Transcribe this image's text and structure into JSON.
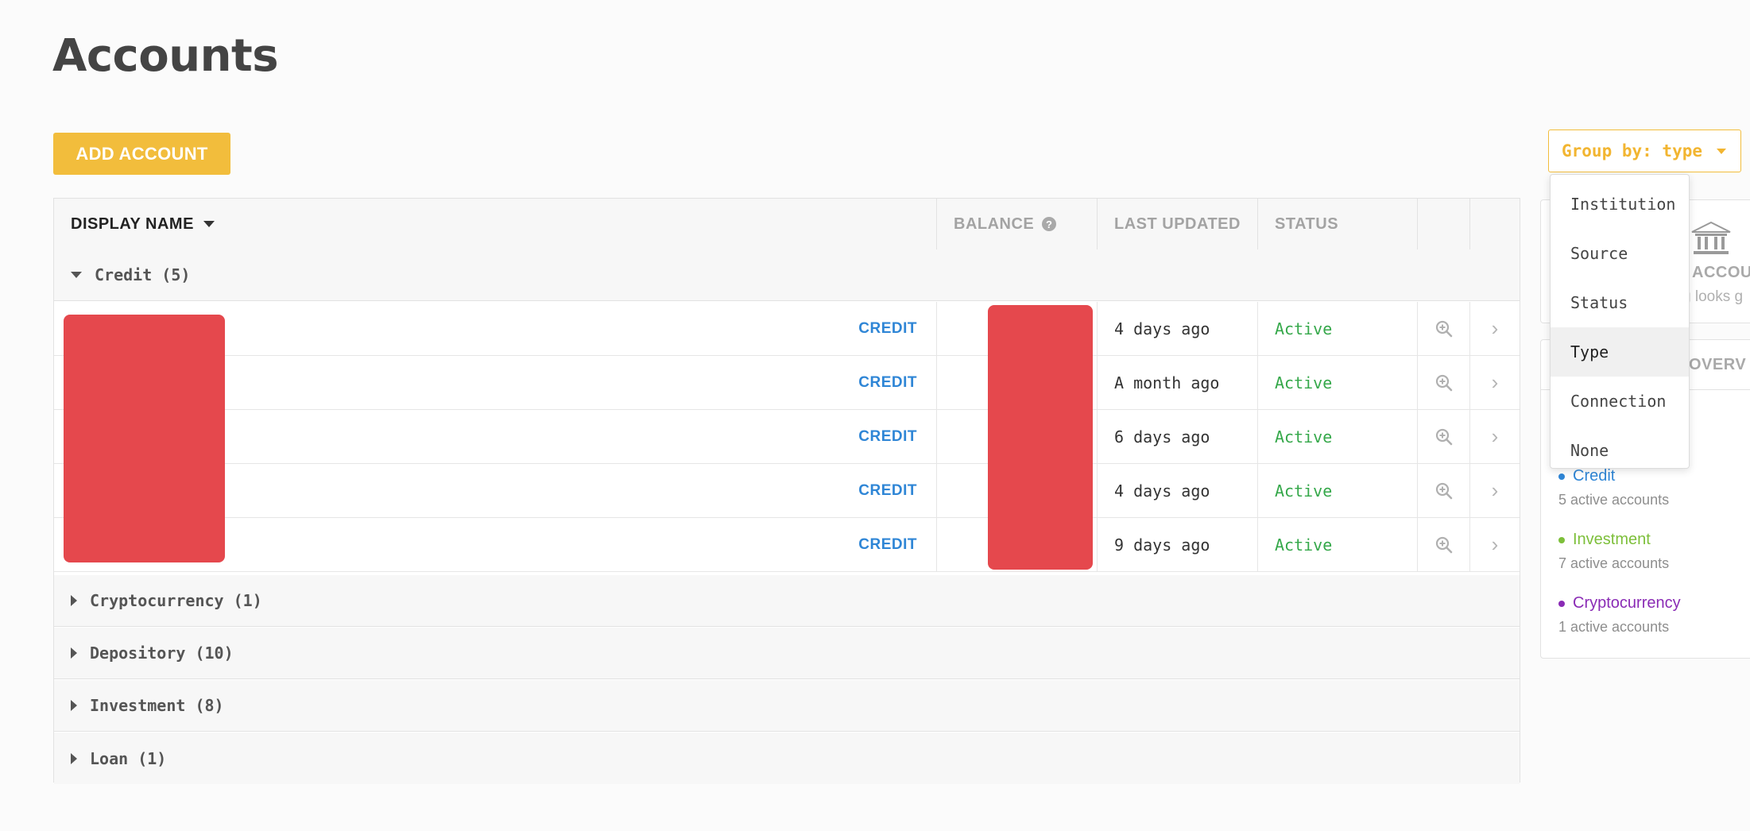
{
  "page": {
    "title": "Accounts"
  },
  "toolbar": {
    "add_label": "ADD ACCOUNT",
    "group_by_label": "Group by: type"
  },
  "group_by_menu": {
    "options": [
      "Institution",
      "Source",
      "Status",
      "Type",
      "Connection",
      "None"
    ],
    "selected": "Type"
  },
  "table": {
    "columns": {
      "name": "DISPLAY NAME",
      "balance": "BALANCE",
      "balance_help": "?",
      "updated": "LAST UPDATED",
      "status": "STATUS"
    },
    "expanded_group": {
      "label": "Credit (5)"
    },
    "rows": [
      {
        "tag": "CREDIT",
        "updated": "4 days ago",
        "status": "Active"
      },
      {
        "tag": "CREDIT",
        "updated": "A month ago",
        "status": "Active"
      },
      {
        "tag": "CREDIT",
        "updated": "6 days ago",
        "status": "Active"
      },
      {
        "tag": "CREDIT",
        "updated": "4 days ago",
        "status": "Active"
      },
      {
        "tag": "CREDIT",
        "updated": "9 days ago",
        "status": "Active"
      }
    ],
    "collapsed_groups": [
      {
        "label": "Cryptocurrency (1)"
      },
      {
        "label": "Depository (10)"
      },
      {
        "label": "Investment (8)"
      },
      {
        "label": "Loan (1)"
      }
    ]
  },
  "side": {
    "panel1_title": "ACCOU",
    "panel1_sub": "g looks g",
    "panel2_tab": "OVERV",
    "legend": [
      {
        "name": "Credit",
        "count": "5 active accounts",
        "color": "#2f86d6"
      },
      {
        "name": "Investment",
        "count": "7 active accounts",
        "color": "#7dbf3a"
      },
      {
        "name": "Cryptocurrency",
        "count": "1 active accounts",
        "color": "#8a2bb5"
      }
    ]
  },
  "colors": {
    "accent": "#f2bd3c",
    "credit_tag": "#2f86d6",
    "status_active": "#35a84a",
    "redaction": "#e5484d"
  }
}
